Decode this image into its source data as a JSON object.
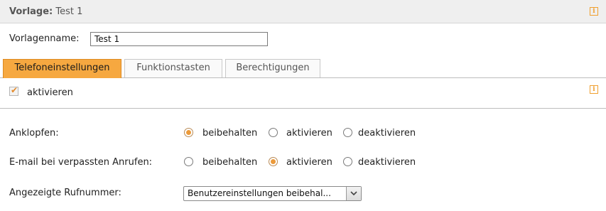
{
  "header": {
    "title_label": "Vorlage:",
    "title_value": "Test 1",
    "info_icon": "info-icon"
  },
  "template_name": {
    "label": "Vorlagenname:",
    "value": "Test 1"
  },
  "tabs": [
    {
      "label": "Telefoneinstellungen",
      "active": true
    },
    {
      "label": "Funktionstasten",
      "active": false
    },
    {
      "label": "Berechtigungen",
      "active": false
    }
  ],
  "activate": {
    "label": "aktivieren",
    "checked": true
  },
  "settings": {
    "knocking": {
      "label": "Anklopfen:",
      "options": [
        "beibehalten",
        "aktivieren",
        "deaktivieren"
      ],
      "selected": "beibehalten"
    },
    "email_missed": {
      "label": "E-mail bei verpassten Anrufen:",
      "options": [
        "beibehalten",
        "aktivieren",
        "deaktivieren"
      ],
      "selected": "aktivieren"
    },
    "displayed_number": {
      "label": "Angezeigte Rufnummer:",
      "selected": "Benutzereinstellungen beibehal..."
    }
  },
  "colors": {
    "accent": "#f6a840",
    "info": "#f0a030"
  }
}
